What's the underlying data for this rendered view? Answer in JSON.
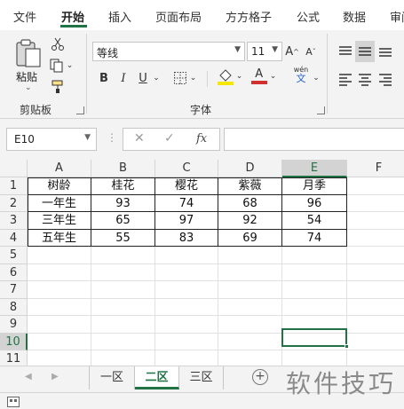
{
  "ribbon_tabs": [
    "文件",
    "开始",
    "插入",
    "页面布局",
    "方方格子",
    "公式",
    "数据",
    "审阅"
  ],
  "ribbon": {
    "clipboard": {
      "paste_label": "粘贴",
      "group_label": "剪贴板"
    },
    "font": {
      "font_name": "等线",
      "font_size": "11",
      "bold": "B",
      "italic": "I",
      "underline": "U",
      "grow": "A",
      "shrink": "A",
      "font_color_letter": "A",
      "phonetic_top": "wén",
      "phonetic_bottom": "文",
      "group_label": "字体"
    }
  },
  "formula_bar": {
    "name_box": "E10",
    "fx_label": "fx",
    "formula": ""
  },
  "grid": {
    "columns": [
      "A",
      "B",
      "C",
      "D",
      "E",
      "F"
    ],
    "selected_column": "E",
    "rows": [
      "1",
      "2",
      "3",
      "4",
      "5",
      "6",
      "7",
      "8",
      "9",
      "10",
      "11"
    ],
    "selected_row": "10",
    "table": [
      [
        "树龄",
        "桂花",
        "樱花",
        "紫薇",
        "月季"
      ],
      [
        "一年生",
        "93",
        "74",
        "68",
        "96"
      ],
      [
        "三年生",
        "65",
        "97",
        "92",
        "54"
      ],
      [
        "五年生",
        "55",
        "83",
        "69",
        "74"
      ]
    ]
  },
  "sheets": [
    "一区",
    "二区",
    "三区"
  ],
  "active_sheet": "二区",
  "watermark": "软件技巧",
  "colors": {
    "accent": "#217346",
    "font_color": "#d32f2f",
    "highlight": "#f5e700"
  }
}
